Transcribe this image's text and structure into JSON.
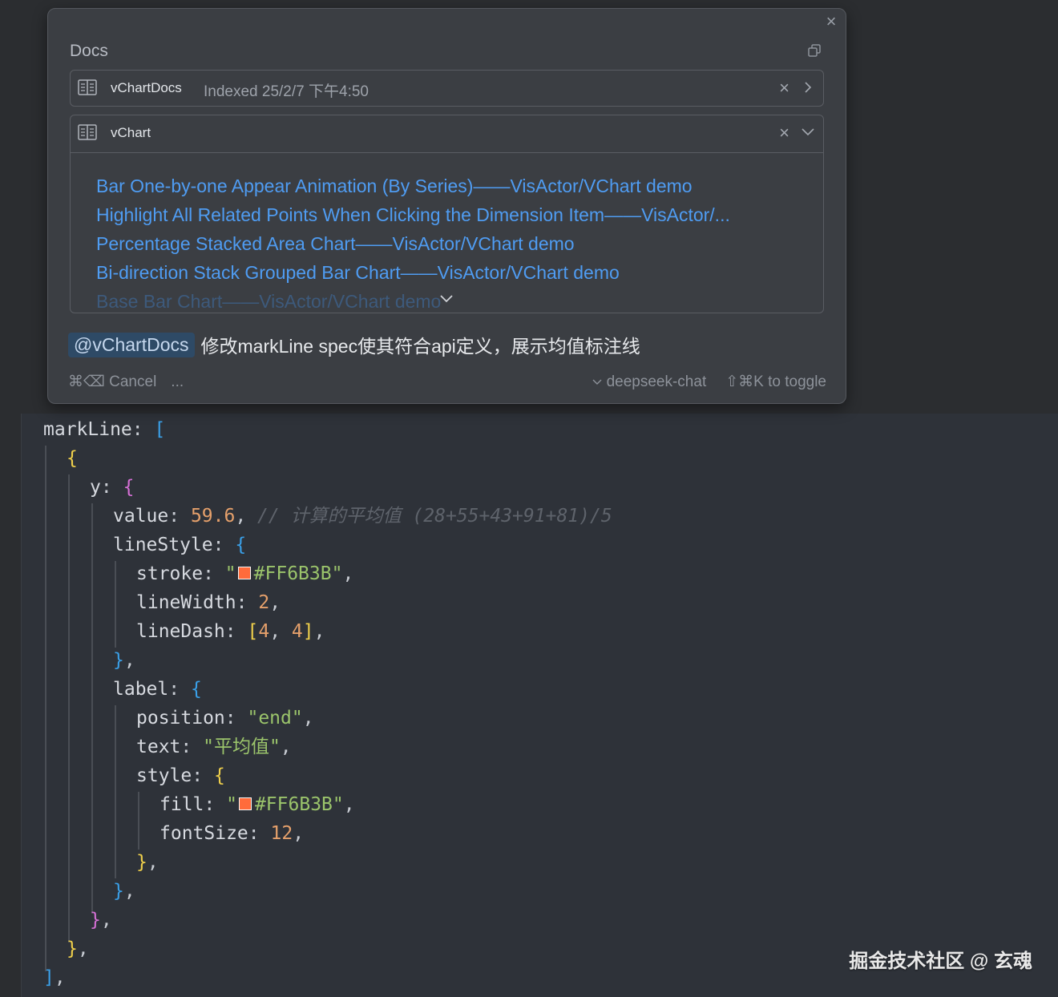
{
  "popup": {
    "docs_title": "Docs",
    "close_glyph": "×",
    "docs": [
      {
        "name": "vChartDocs",
        "meta": "Indexed 25/2/7 下午4:50",
        "remove_glyph": "×"
      },
      {
        "name": "vChart",
        "remove_glyph": "×"
      }
    ],
    "links": [
      "Bar One-by-one Appear Animation (By Series)——VisActor/VChart demo",
      "Highlight All Related Points When Clicking the Dimension Item——VisActor/...",
      "Percentage Stacked Area Chart——VisActor/VChart demo",
      "Bi-direction Stack Grouped Bar Chart——VisActor/VChart demo",
      "Base Bar Chart——VisActor/VChart demo"
    ],
    "mention": "@vChartDocs",
    "prompt": "修改markLine spec使其符合api定义，展示均值标注线",
    "cancel": "⌘⌫ Cancel",
    "more": "...",
    "model": "deepseek-chat",
    "toggle": "⇧⌘K to toggle"
  },
  "code": {
    "l1_key": "markLine",
    "l3_key": "y",
    "l4_key": "value",
    "l4_val": "59.6",
    "l4_comment": "// 计算的平均值 (28+55+43+91+81)/5",
    "l5_key": "lineStyle",
    "l6_key": "stroke",
    "l6_val": "#FF6B3B",
    "l7_key": "lineWidth",
    "l7_val": "2",
    "l8_key": "lineDash",
    "l8_a": "4",
    "l8_b": "4",
    "l10_key": "label",
    "l11_key": "position",
    "l11_val": "\"end\"",
    "l12_key": "text",
    "l12_val": "\"平均值\"",
    "l13_key": "style",
    "l14_key": "fill",
    "l14_val": "#FF6B3B",
    "l15_key": "fontSize",
    "l15_val": "12"
  },
  "colors": {
    "swatch": "#ff6b3b",
    "link": "#4f9cf2"
  },
  "watermark": "掘金技术社区 @ 玄魂"
}
